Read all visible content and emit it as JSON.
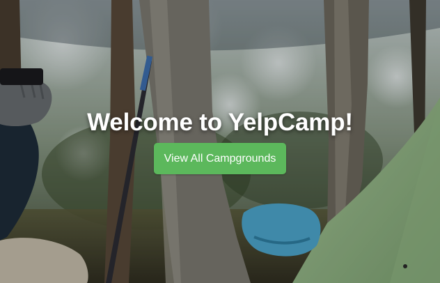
{
  "hero": {
    "title": "Welcome to YelpCamp!",
    "cta_label": "View All Campgrounds"
  },
  "colors": {
    "button_bg": "#5cb85c",
    "title_text": "#ffffff"
  }
}
